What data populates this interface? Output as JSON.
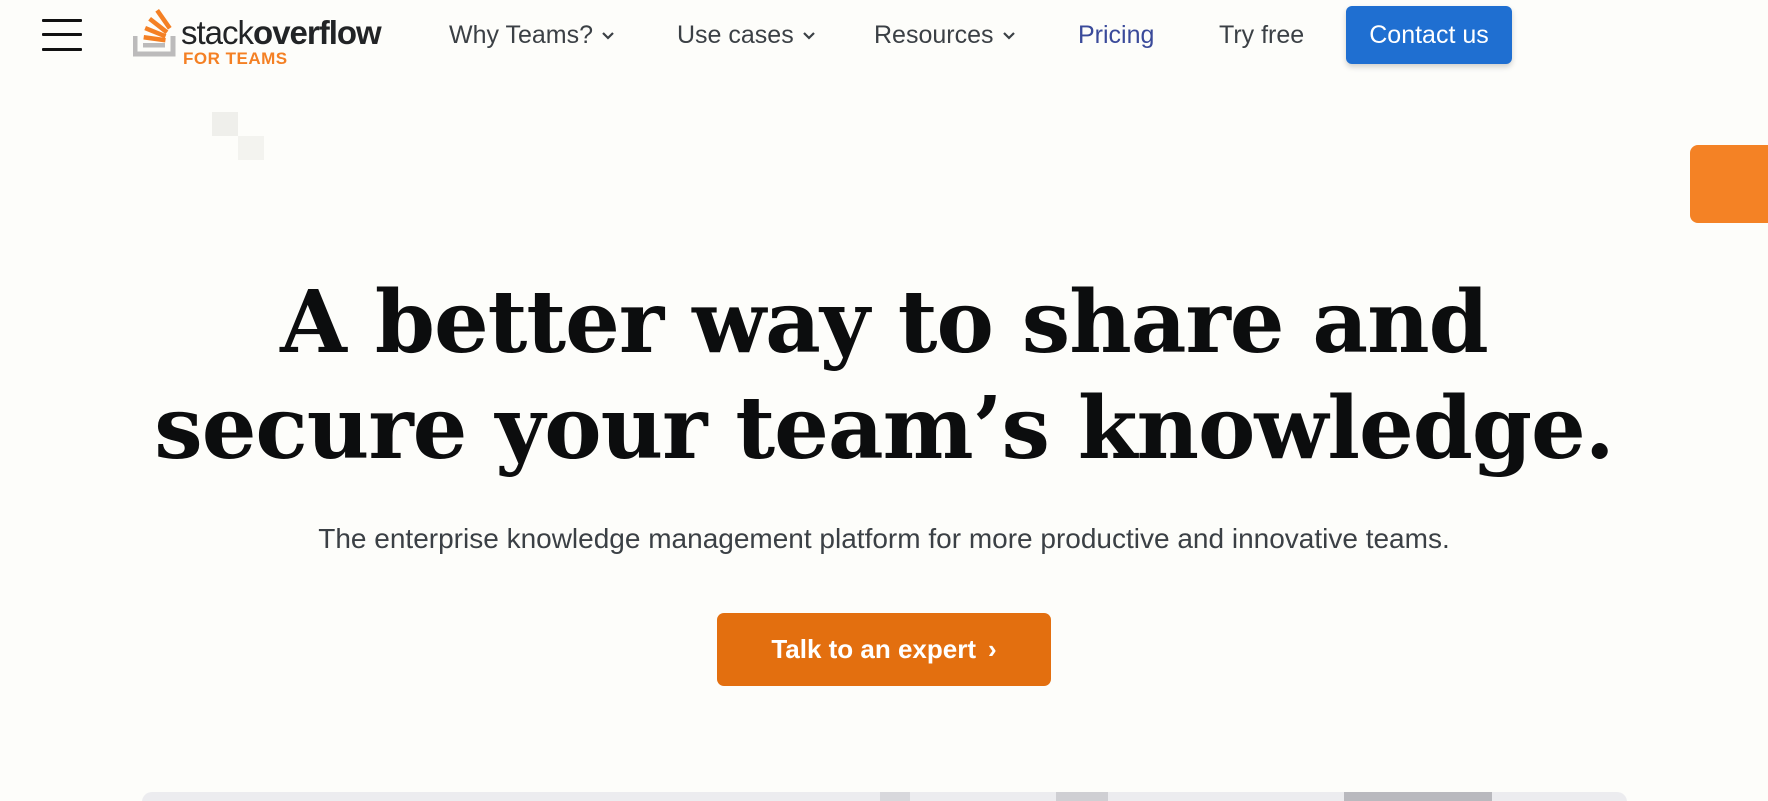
{
  "header": {
    "logo": {
      "word_light": "stack",
      "word_bold": "overflow",
      "sub": "FOR TEAMS"
    },
    "nav": [
      {
        "label": "Why Teams?",
        "has_dropdown": true
      },
      {
        "label": "Use cases",
        "has_dropdown": true
      },
      {
        "label": "Resources",
        "has_dropdown": true
      },
      {
        "label": "Pricing",
        "has_dropdown": false
      },
      {
        "label": "Try free",
        "has_dropdown": false
      }
    ],
    "contact_label": "Contact us"
  },
  "hero": {
    "title_part1": "A better way to ",
    "title_bold1": "share and",
    "title_bold2": "secure",
    "title_part2": " your team’s knowledge.",
    "subtitle": "The enterprise knowledge management platform for more productive and innovative teams.",
    "cta_label": "Talk to an expert",
    "cta_arrow": "›"
  },
  "icons": {
    "menu": "hamburger-menu-icon",
    "chevron": "chevron-down-icon",
    "logo": "stack-overflow-logo-icon"
  },
  "colors": {
    "background": "#fdfdfa",
    "brand_orange": "#f48024",
    "cta_orange": "#e36f0f",
    "contact_blue": "#1f6fd1",
    "pricing_link": "#3a4a9a",
    "text_dark": "#0c0d0e"
  }
}
